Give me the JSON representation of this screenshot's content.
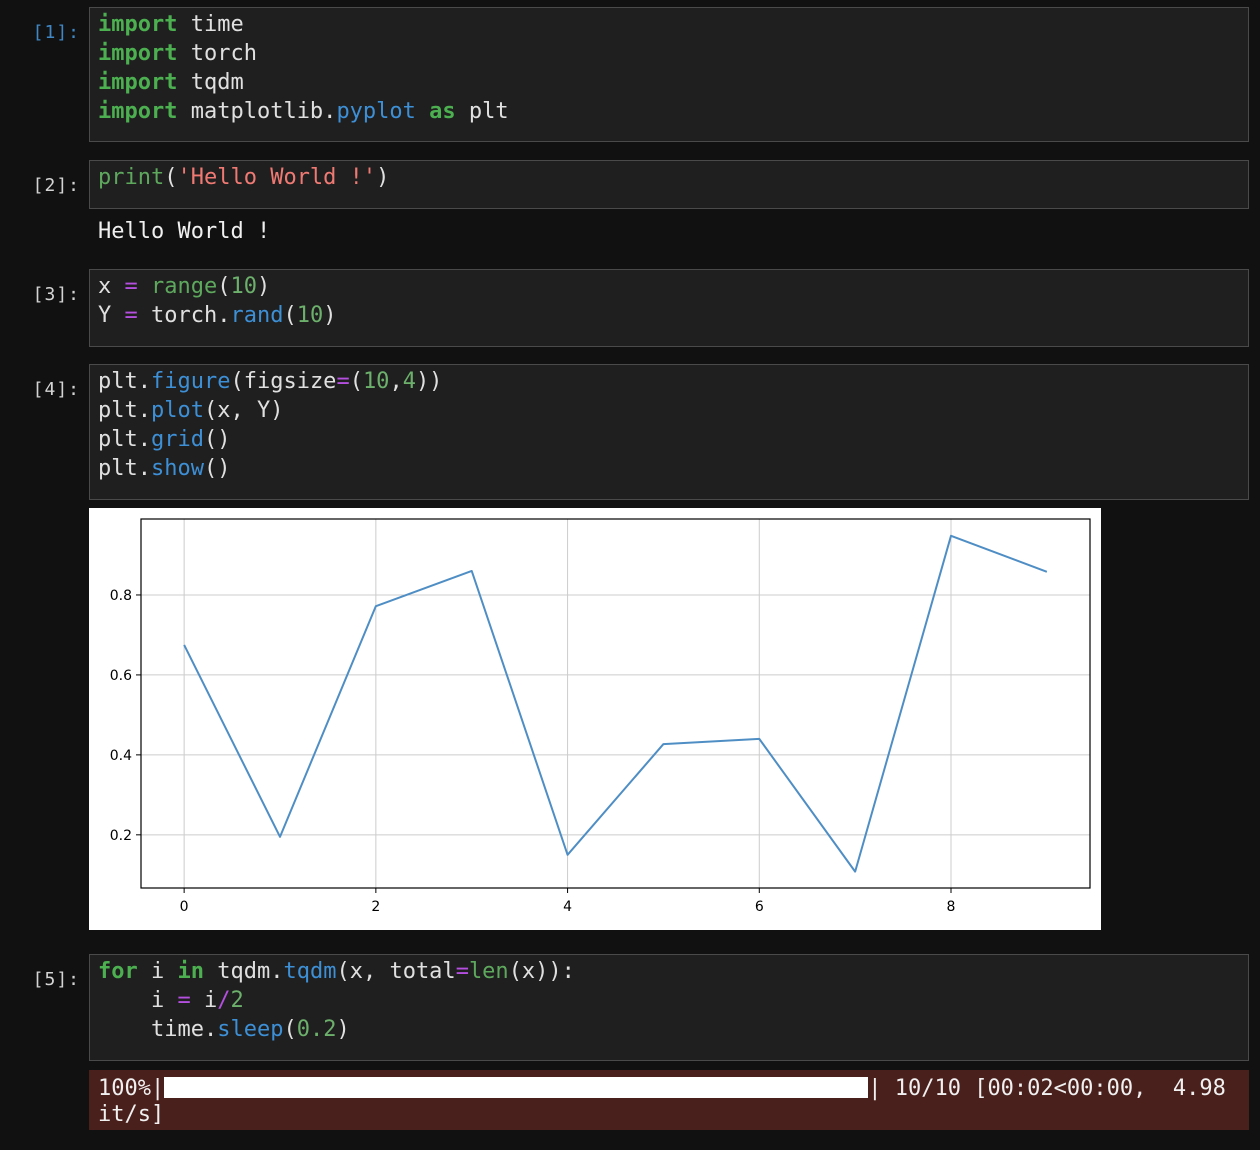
{
  "cells": {
    "c1": {
      "prompt": "[1]:",
      "lines": [
        [
          {
            "t": "import",
            "c": "kw"
          },
          {
            "t": " time"
          }
        ],
        [
          {
            "t": "import",
            "c": "kw"
          },
          {
            "t": " torch"
          }
        ],
        [
          {
            "t": "import",
            "c": "kw"
          },
          {
            "t": " tqdm"
          }
        ],
        [
          {
            "t": "import",
            "c": "kw"
          },
          {
            "t": " matplotlib."
          },
          {
            "t": "pyplot",
            "c": "fn"
          },
          {
            "t": " "
          },
          {
            "t": "as",
            "c": "kw"
          },
          {
            "t": " plt"
          }
        ]
      ]
    },
    "c2": {
      "prompt": "[2]:",
      "lines": [
        [
          {
            "t": "print",
            "c": "bi"
          },
          {
            "t": "("
          },
          {
            "t": "'Hello World !'",
            "c": "str"
          },
          {
            "t": ")"
          }
        ]
      ],
      "output": "Hello World !"
    },
    "c3": {
      "prompt": "[3]:",
      "lines": [
        [
          {
            "t": "x "
          },
          {
            "t": "=",
            "c": "op"
          },
          {
            "t": " "
          },
          {
            "t": "range",
            "c": "bi"
          },
          {
            "t": "("
          },
          {
            "t": "10",
            "c": "num"
          },
          {
            "t": ")"
          }
        ],
        [
          {
            "t": "Y "
          },
          {
            "t": "=",
            "c": "op"
          },
          {
            "t": " torch."
          },
          {
            "t": "rand",
            "c": "fn"
          },
          {
            "t": "("
          },
          {
            "t": "10",
            "c": "num"
          },
          {
            "t": ")"
          }
        ]
      ]
    },
    "c4": {
      "prompt": "[4]:",
      "lines": [
        [
          {
            "t": "plt."
          },
          {
            "t": "figure",
            "c": "fn"
          },
          {
            "t": "(figsize"
          },
          {
            "t": "=",
            "c": "op"
          },
          {
            "t": "("
          },
          {
            "t": "10",
            "c": "num"
          },
          {
            "t": ","
          },
          {
            "t": "4",
            "c": "num"
          },
          {
            "t": "))"
          }
        ],
        [
          {
            "t": "plt."
          },
          {
            "t": "plot",
            "c": "fn"
          },
          {
            "t": "(x, Y)"
          }
        ],
        [
          {
            "t": "plt."
          },
          {
            "t": "grid",
            "c": "fn"
          },
          {
            "t": "()"
          }
        ],
        [
          {
            "t": "plt."
          },
          {
            "t": "show",
            "c": "fn"
          },
          {
            "t": "()"
          }
        ]
      ]
    },
    "c5": {
      "prompt": "[5]:",
      "lines": [
        [
          {
            "t": "for",
            "c": "kw"
          },
          {
            "t": " i "
          },
          {
            "t": "in",
            "c": "kw"
          },
          {
            "t": " tqdm."
          },
          {
            "t": "tqdm",
            "c": "fn"
          },
          {
            "t": "(x, total"
          },
          {
            "t": "=",
            "c": "op"
          },
          {
            "t": "len",
            "c": "bi"
          },
          {
            "t": "(x)):"
          }
        ],
        [
          {
            "t": "    i "
          },
          {
            "t": "=",
            "c": "op"
          },
          {
            "t": " i"
          },
          {
            "t": "/",
            "c": "op"
          },
          {
            "t": "2",
            "c": "num"
          }
        ],
        [
          {
            "t": "    time."
          },
          {
            "t": "sleep",
            "c": "fn"
          },
          {
            "t": "("
          },
          {
            "t": "0.2",
            "c": "num"
          },
          {
            "t": ")"
          }
        ]
      ]
    }
  },
  "progress": {
    "percent_label": "100%|",
    "fraction": 1.0,
    "tail": "| 10/10 [00:02<00:00,  4.98",
    "line2": "it/s]"
  },
  "colors": {
    "line": "#4f8ec4",
    "grid": "#cccccc",
    "prompt_active": "#3f87c5",
    "stderr_bg": "#4a201c"
  },
  "chart_data": {
    "type": "line",
    "x": [
      0,
      1,
      2,
      3,
      4,
      5,
      6,
      7,
      8,
      9
    ],
    "series": [
      {
        "values": [
          0.675,
          0.195,
          0.772,
          0.86,
          0.15,
          0.427,
          0.44,
          0.108,
          0.948,
          0.858
        ]
      }
    ],
    "xticks": [
      0,
      2,
      4,
      6,
      8
    ],
    "yticks": [
      0.2,
      0.4,
      0.6,
      0.8
    ],
    "ytick_labels": [
      "0.2",
      "0.4",
      "0.6",
      "0.8"
    ],
    "xtick_labels": [
      "0",
      "2",
      "4",
      "6",
      "8"
    ],
    "xlim": [
      -0.45,
      9.45
    ],
    "ylim": [
      0.067,
      0.99
    ],
    "grid": true,
    "title": "",
    "xlabel": "",
    "ylabel": ""
  }
}
